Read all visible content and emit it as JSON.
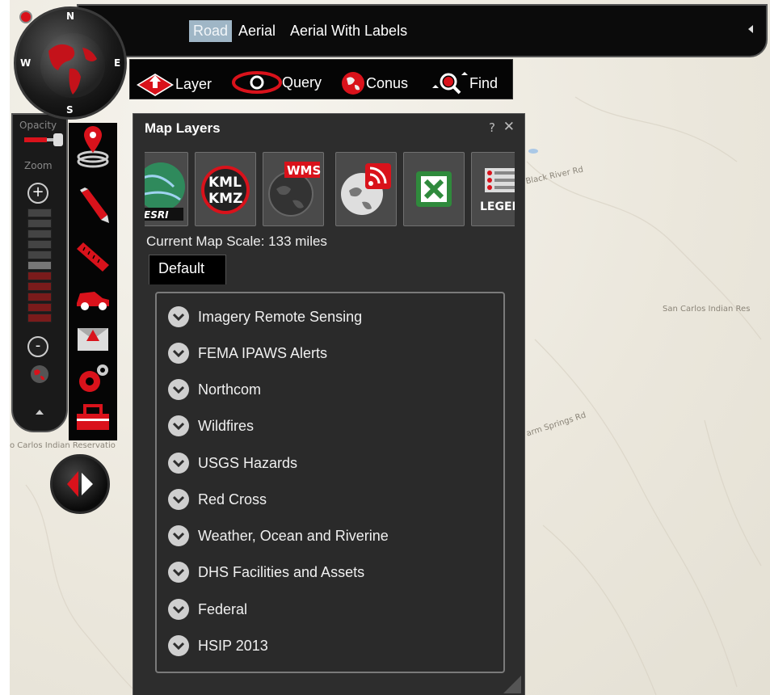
{
  "basemaps": {
    "items": [
      {
        "label": "Road",
        "active": true
      },
      {
        "label": "Aerial",
        "active": false
      },
      {
        "label": "Aerial With Labels",
        "active": false
      }
    ]
  },
  "toolbar": {
    "layer": "Layer",
    "query": "Query",
    "conus": "Conus",
    "find": "Find"
  },
  "compass": {
    "n": "N",
    "s": "S",
    "e": "E",
    "w": "W"
  },
  "side": {
    "opacity_label": "Opacity",
    "zoom_label": "Zoom",
    "zoom_in": "+",
    "zoom_out": "-"
  },
  "map_labels": {
    "black_river": "Black River Rd",
    "san_carlos_right": "San Carlos Indian Res",
    "san_carlos_left": "o Carlos Indian Reservatio",
    "warm_springs": "arm Springs Rd"
  },
  "dialog": {
    "title": "Map Layers",
    "help": "?",
    "close": "✕",
    "scale_text": "Current Map Scale: 133 miles",
    "tab": "Default",
    "icons": [
      {
        "name": "esri-icon",
        "label": "ESRI"
      },
      {
        "name": "kml-kmz-icon",
        "label": "KML KMZ"
      },
      {
        "name": "wms-icon",
        "label": "WMS"
      },
      {
        "name": "rss-icon",
        "label": ""
      },
      {
        "name": "excel-icon",
        "label": ""
      },
      {
        "name": "legend-icon",
        "label": "LEGEI"
      }
    ],
    "layers": [
      "Imagery Remote Sensing",
      "FEMA IPAWS Alerts",
      "Northcom",
      "Wildfires",
      "USGS Hazards",
      "Red Cross",
      "Weather, Ocean and Riverine",
      "DHS Facilities and Assets",
      "Federal",
      "HSIP 2013"
    ]
  },
  "colors": {
    "accent_red": "#d9121b",
    "active_basemap": "#9fb6c6",
    "panel_dark": "#2d2d2d"
  }
}
